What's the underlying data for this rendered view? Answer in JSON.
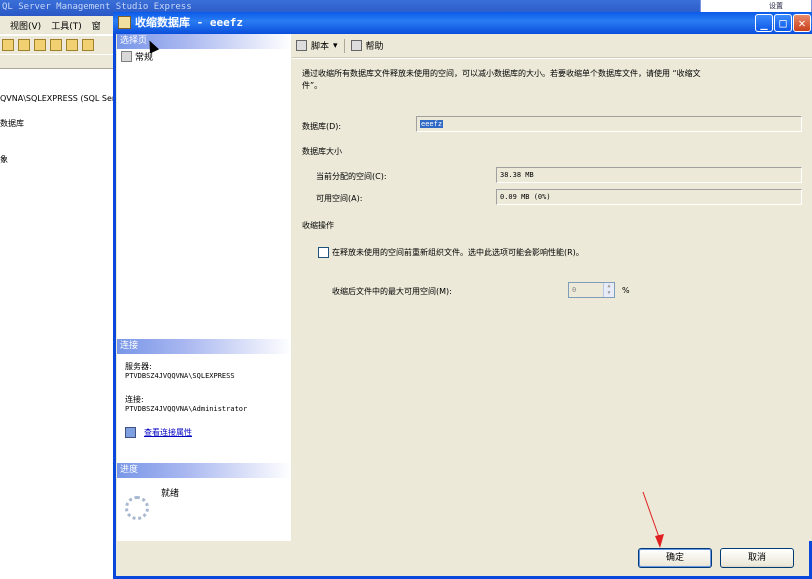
{
  "background_app": {
    "title": "QL Server Management Studio Express",
    "menu": [
      "视图(V)",
      "工具(T)",
      "窗"
    ],
    "tree": {
      "server": "QVNA\\SQLEXPRESS (SQL Serv",
      "databases": "数据库",
      "objects": "象"
    },
    "logo_text": "设置"
  },
  "dialog": {
    "title": "收缩数据库 - eeefz",
    "minimize": "_",
    "maximize": "□",
    "close": "✕"
  },
  "left": {
    "select_page_header": "选择页",
    "pages": [
      {
        "label": "常规",
        "icon": "page-icon"
      }
    ],
    "connection_header": "连接",
    "server_label": "服务器:",
    "server_value": "PTVDBSZ4JVQQVNA\\SQLEXPRESS",
    "connection_label": "连接:",
    "connection_value": "PTVDBSZ4JVQQVNA\\Administrator",
    "view_props_link": "查看连接属性",
    "progress_header": "进度",
    "progress_status": "就绪"
  },
  "right": {
    "toolbar": {
      "script": "脚本",
      "help": "帮助"
    },
    "description": "通过收缩所有数据库文件释放未使用的空间，可以减小数据库的大小。若要收缩单个数据库文件，请使用 “收缩文",
    "description2": "件”。",
    "database_label": "数据库(D):",
    "database_value": "eeefz",
    "db_size_header": "数据库大小",
    "allocated_label": "当前分配的空间(C):",
    "allocated_value": "38.38 MB",
    "available_label": "可用空间(A):",
    "available_value": "0.09 MB (0%)",
    "shrink_header": "收缩操作",
    "reorganize_checkbox": "在释放未使用的空间前重新组织文件。选中此选项可能会影响性能(R)。",
    "reorganize_checked": false,
    "max_free_label": "收缩后文件中的最大可用空间(M):",
    "max_free_value": "0",
    "max_free_unit": "%"
  },
  "buttons": {
    "ok": "确定",
    "cancel": "取消"
  },
  "colors": {
    "title_bar": "#0a48dc",
    "section_header": "#7896e8",
    "annotation_arrow": "#e02020"
  }
}
